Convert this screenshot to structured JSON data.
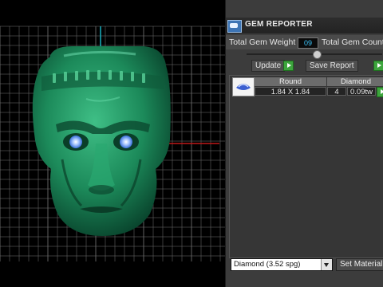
{
  "panel": {
    "title": "GEM REPORTER",
    "total_weight_label": "Total Gem Weight",
    "total_weight_value": "09",
    "total_count_label": "Total Gem Count",
    "update_label": "Update",
    "save_report_label": "Save Report"
  },
  "gem_table": {
    "headers": [
      "Round",
      "Diamond"
    ],
    "row": {
      "size": "1.84 X 1.84",
      "count": "4",
      "weight": "0.09tw"
    }
  },
  "material": {
    "selected": "Diamond    (3.52 spg)",
    "set_material_label": "Set Material"
  },
  "colors": {
    "viewport_bg": "#000000",
    "grid": "#6a6a6a",
    "model_green": "#1e8a5a",
    "axis_red": "#c01818",
    "axis_cyan": "#19b0c0"
  }
}
